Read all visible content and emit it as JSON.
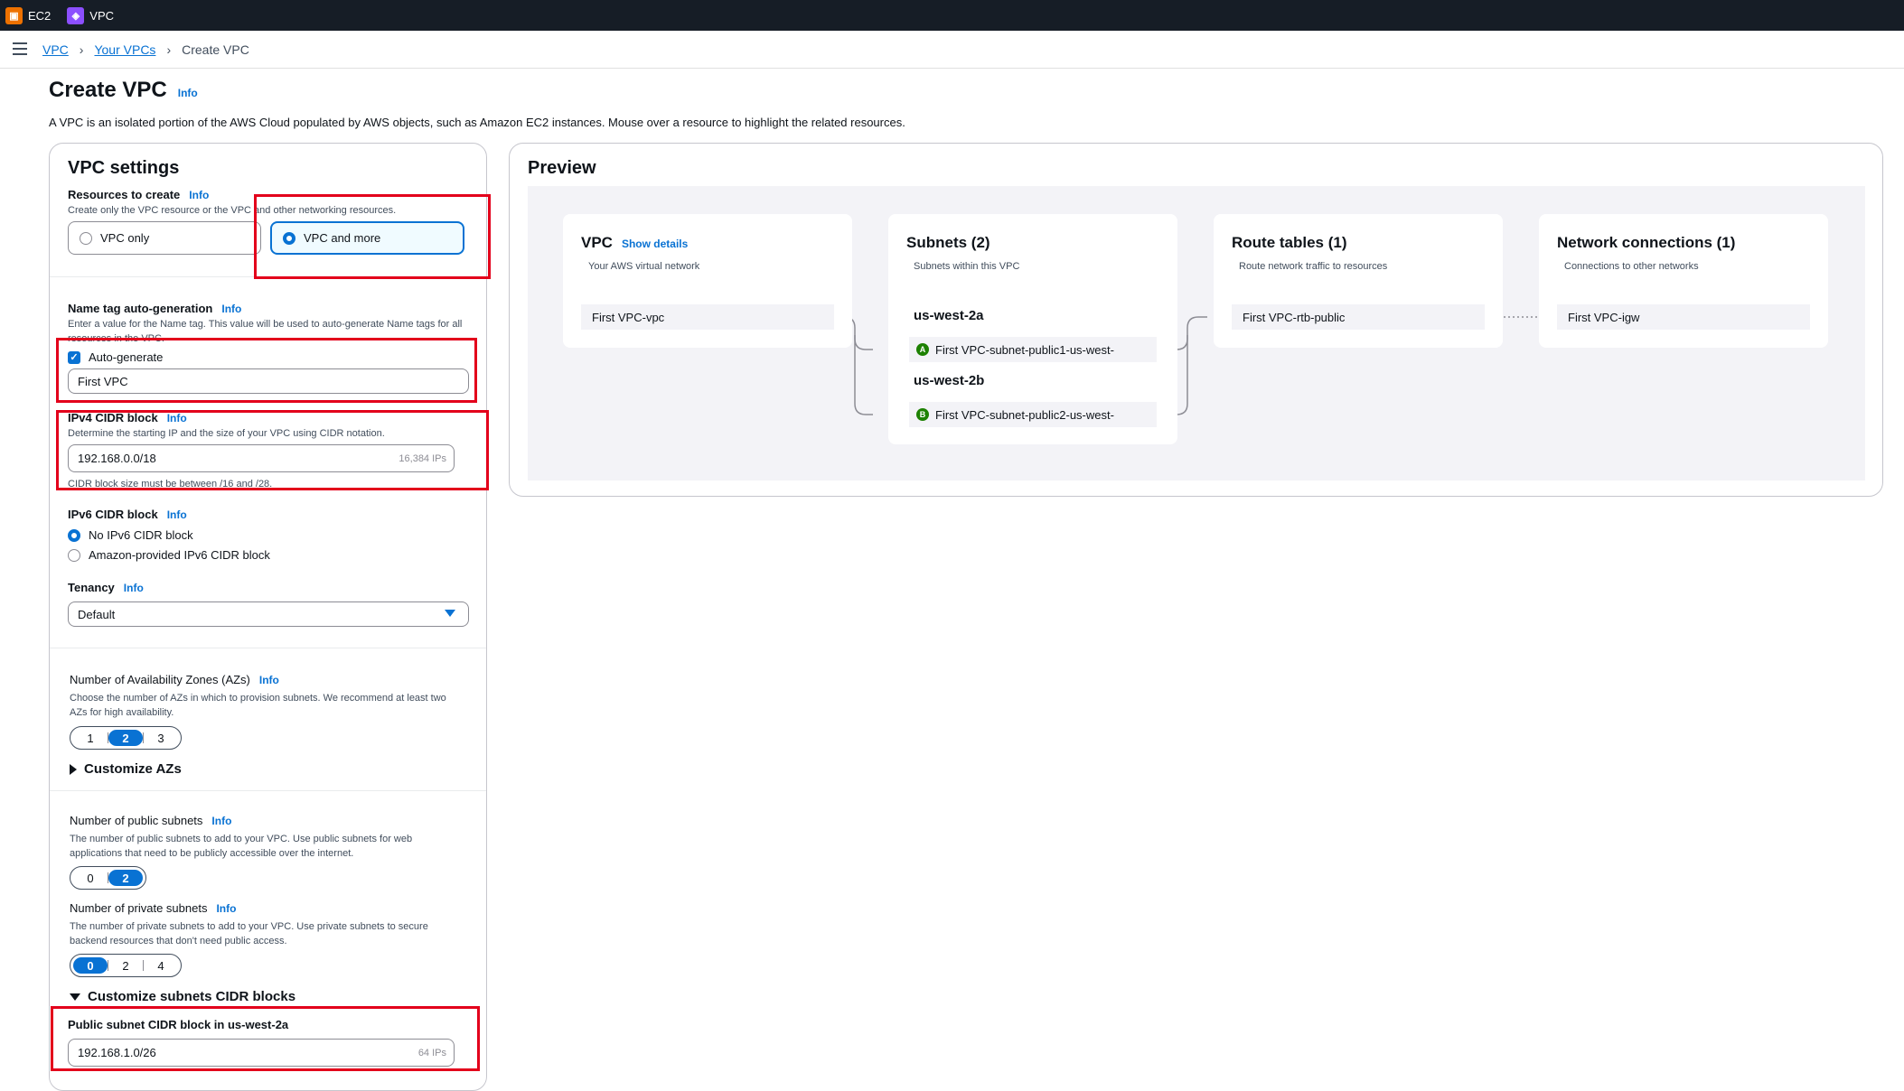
{
  "topbar": {
    "services": [
      {
        "label": "EC2",
        "icon": "ec2-service-icon",
        "color": "#ed7100"
      },
      {
        "label": "VPC",
        "icon": "vpc-service-icon",
        "color": "#8c4fff"
      }
    ]
  },
  "breadcrumb": [
    "VPC",
    "Your VPCs",
    "Create VPC"
  ],
  "page": {
    "title": "Create VPC",
    "info": "Info",
    "description": "A VPC is an isolated portion of the AWS Cloud populated by AWS objects, such as Amazon EC2 instances. Mouse over a resource to highlight the related resources."
  },
  "settings": {
    "title": "VPC settings",
    "resources": {
      "label": "Resources to create",
      "info": "Info",
      "hint": "Create only the VPC resource or the VPC and other networking resources.",
      "options": [
        "VPC only",
        "VPC and more"
      ],
      "selected": "VPC and more"
    },
    "name_tag": {
      "label": "Name tag auto-generation",
      "info": "Info",
      "hint": "Enter a value for the Name tag. This value will be used to auto-generate Name tags for all resources in the VPC.",
      "checkbox_label": "Auto-generate",
      "checked": true,
      "value": "First VPC"
    },
    "ipv4": {
      "label": "IPv4 CIDR block",
      "info": "Info",
      "hint": "Determine the starting IP and the size of your VPC using CIDR notation.",
      "value": "192.168.0.0/18",
      "suffix": "16,384 IPs",
      "constraint": "CIDR block size must be between /16 and /28."
    },
    "ipv6": {
      "label": "IPv6 CIDR block",
      "info": "Info",
      "options": [
        "No IPv6 CIDR block",
        "Amazon-provided IPv6 CIDR block"
      ],
      "selected": "No IPv6 CIDR block"
    },
    "tenancy": {
      "label": "Tenancy",
      "info": "Info",
      "value": "Default"
    },
    "azs": {
      "label": "Number of Availability Zones (AZs)",
      "info": "Info",
      "hint": "Choose the number of AZs in which to provision subnets. We recommend at least two AZs for high availability.",
      "options": [
        "1",
        "2",
        "3"
      ],
      "selected": "2",
      "customize": "Customize AZs"
    },
    "public_subnets": {
      "label": "Number of public subnets",
      "info": "Info",
      "hint": "The number of public subnets to add to your VPC. Use public subnets for web applications that need to be publicly accessible over the internet.",
      "options": [
        "0",
        "2"
      ],
      "selected": "2"
    },
    "private_subnets": {
      "label": "Number of private subnets",
      "info": "Info",
      "hint": "The number of private subnets to add to your VPC. Use private subnets to secure backend resources that don't need public access.",
      "options": [
        "0",
        "2",
        "4"
      ],
      "selected": "0"
    },
    "cidr_custom": {
      "label": "Customize subnets CIDR blocks",
      "public_label": "Public subnet CIDR block in us-west-2a",
      "value": "192.168.1.0/26",
      "suffix": "64 IPs"
    }
  },
  "preview": {
    "title": "Preview",
    "vpc": {
      "title": "VPC",
      "link": "Show details",
      "sub": "Your AWS virtual network",
      "node": "First VPC-vpc"
    },
    "subnets": {
      "title": "Subnets (2)",
      "sub": "Subnets within this VPC",
      "azs": [
        {
          "name": "us-west-2a",
          "badge": "A",
          "subnet": "First VPC-subnet-public1-us-west-"
        },
        {
          "name": "us-west-2b",
          "badge": "B",
          "subnet": "First VPC-subnet-public2-us-west-"
        }
      ]
    },
    "route_tables": {
      "title": "Route tables (1)",
      "sub": "Route network traffic to resources",
      "node": "First VPC-rtb-public"
    },
    "network": {
      "title": "Network connections (1)",
      "sub": "Connections to other networks",
      "node": "First VPC-igw"
    }
  },
  "colors": {
    "accent": "#0972d3",
    "highlight": "#e3001b",
    "success": "#1d8102"
  }
}
